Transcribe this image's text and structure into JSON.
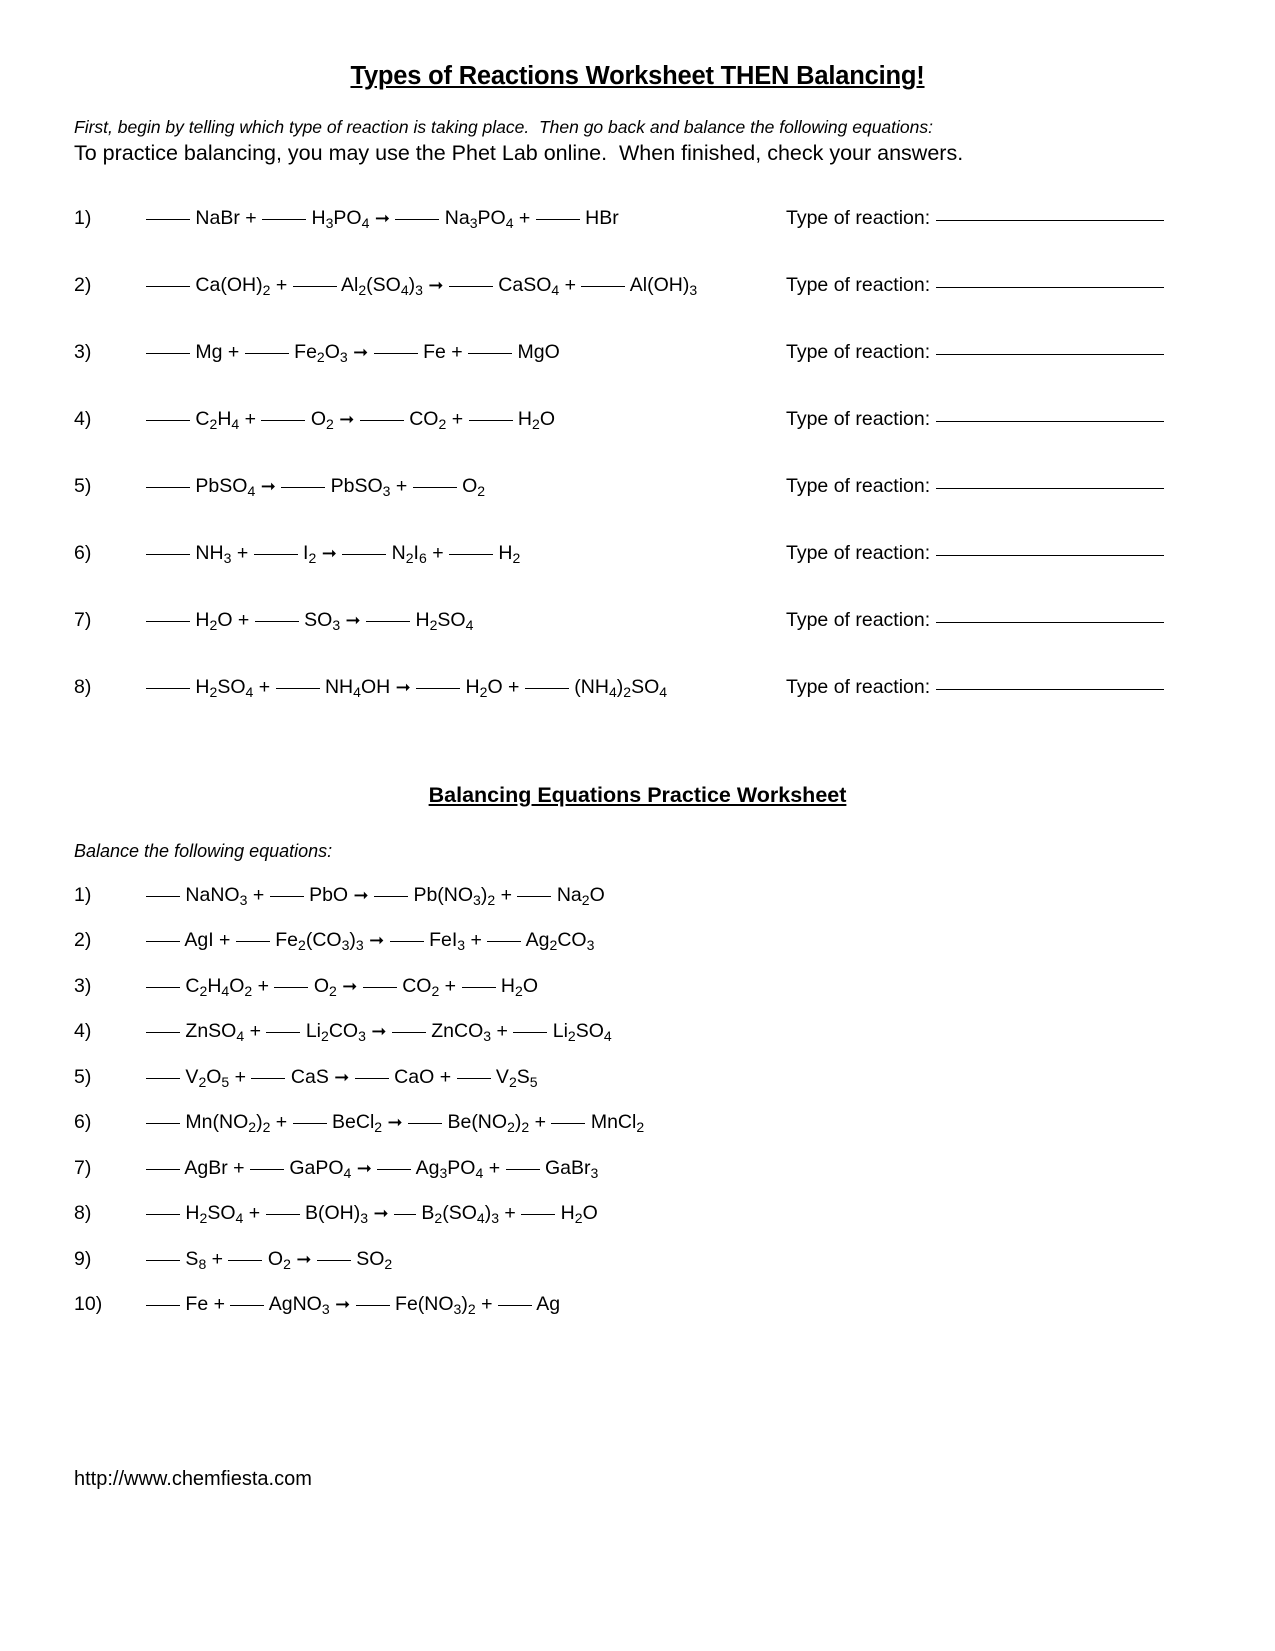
{
  "document": {
    "title": "Types of Reactions Worksheet THEN Balancing!",
    "intro_italic": "First, begin by telling which type of reaction is taking place.  Then go back and balance the following equations:",
    "intro_plain": "To practice balancing, you may use the Phet Lab online.  When finished, check your answers.",
    "footer_url": "http://www.chemfiesta.com"
  },
  "section1": {
    "type_of_reaction_label": "Type of reaction:",
    "items": [
      {
        "number": "1)",
        "equation_text": "____ NaBr + ____ H3PO4 → ____ Na3PO4 + ____ HBr",
        "reactants": [
          "NaBr",
          "H3PO4"
        ],
        "products": [
          "Na3PO4",
          "HBr"
        ]
      },
      {
        "number": "2)",
        "equation_text": "____ Ca(OH)2 + ____ Al2(SO4)3 → ____ CaSO4 + ____ Al(OH)3",
        "reactants": [
          "Ca(OH)2",
          "Al2(SO4)3"
        ],
        "products": [
          "CaSO4",
          "Al(OH)3"
        ]
      },
      {
        "number": "3)",
        "equation_text": "____ Mg + ____ Fe2O3 → ____ Fe + ____ MgO",
        "reactants": [
          "Mg",
          "Fe2O3"
        ],
        "products": [
          "Fe",
          "MgO"
        ]
      },
      {
        "number": "4)",
        "equation_text": "____ C2H4 + ____ O2 → ____ CO2 + ____ H2O",
        "reactants": [
          "C2H4",
          "O2"
        ],
        "products": [
          "CO2",
          "H2O"
        ]
      },
      {
        "number": "5)",
        "equation_text": "____ PbSO4 → ____ PbSO3 + ____ O2",
        "reactants": [
          "PbSO4"
        ],
        "products": [
          "PbSO3",
          "O2"
        ]
      },
      {
        "number": "6)",
        "equation_text": "____ NH3 + ____ I2 → ____ N2I6 + ____ H2",
        "reactants": [
          "NH3",
          "I2"
        ],
        "products": [
          "N2I6",
          "H2"
        ]
      },
      {
        "number": "7)",
        "equation_text": "____ H2O + ____ SO3 → ____ H2SO4",
        "reactants": [
          "H2O",
          "SO3"
        ],
        "products": [
          "H2SO4"
        ]
      },
      {
        "number": "8)",
        "equation_text": "____ H2SO4 + ____ NH4OH → ____ H2O + ____ (NH4)2SO4",
        "reactants": [
          "H2SO4",
          "NH4OH"
        ],
        "products": [
          "H2O",
          "(NH4)2SO4"
        ]
      }
    ]
  },
  "section2": {
    "title": "Balancing Equations Practice Worksheet",
    "instruction": "Balance the following equations:",
    "items": [
      {
        "number": "1)",
        "equation_text": "___ NaNO3 + ___ PbO → ___ Pb(NO3)2 + ___ Na2O",
        "reactants": [
          "NaNO3",
          "PbO"
        ],
        "products": [
          "Pb(NO3)2",
          "Na2O"
        ]
      },
      {
        "number": "2)",
        "equation_text": "___ AgI + ___ Fe2(CO3)3 → ___ FeI3 + ___ Ag2CO3",
        "reactants": [
          "AgI",
          "Fe2(CO3)3"
        ],
        "products": [
          "FeI3",
          "Ag2CO3"
        ]
      },
      {
        "number": "3)",
        "equation_text": "___ C2H4O2 + ___ O2 → ___ CO2 + ___ H2O",
        "reactants": [
          "C2H4O2",
          "O2"
        ],
        "products": [
          "CO2",
          "H2O"
        ]
      },
      {
        "number": "4)",
        "equation_text": "___ ZnSO4 + ___ Li2CO3 → ___ ZnCO3 + ___ Li2SO4",
        "reactants": [
          "ZnSO4",
          "Li2CO3"
        ],
        "products": [
          "ZnCO3",
          "Li2SO4"
        ]
      },
      {
        "number": "5)",
        "equation_text": "___ V2O5 + ___ CaS → ___ CaO + ___ V2S5",
        "reactants": [
          "V2O5",
          "CaS"
        ],
        "products": [
          "CaO",
          "V2S5"
        ]
      },
      {
        "number": "6)",
        "equation_text": "___ Mn(NO2)2 + ___ BeCl2 → ___ Be(NO2)2 + ___ MnCl2",
        "reactants": [
          "Mn(NO2)2",
          "BeCl2"
        ],
        "products": [
          "Be(NO2)2",
          "MnCl2"
        ]
      },
      {
        "number": "7)",
        "equation_text": "___ AgBr + ___ GaPO4 → ___ Ag3PO4 + ___ GaBr3",
        "reactants": [
          "AgBr",
          "GaPO4"
        ],
        "products": [
          "Ag3PO4",
          "GaBr3"
        ]
      },
      {
        "number": "8)",
        "equation_text": "___ H2SO4 + ___ B(OH)3 → __ B2(SO4)3 + ___ H2O",
        "reactants": [
          "H2SO4",
          "B(OH)3"
        ],
        "products": [
          "B2(SO4)3",
          "H2O"
        ]
      },
      {
        "number": "9)",
        "equation_text": "___ S8 + ___ O2 → ___ SO2",
        "reactants": [
          "S8",
          "O2"
        ],
        "products": [
          "SO2"
        ]
      },
      {
        "number": "10)",
        "equation_text": "___ Fe + ___ AgNO3 → ___ Fe(NO3)2 + ___ Ag",
        "reactants": [
          "Fe",
          "AgNO3"
        ],
        "products": [
          "Fe(NO3)2",
          "Ag"
        ]
      }
    ]
  }
}
